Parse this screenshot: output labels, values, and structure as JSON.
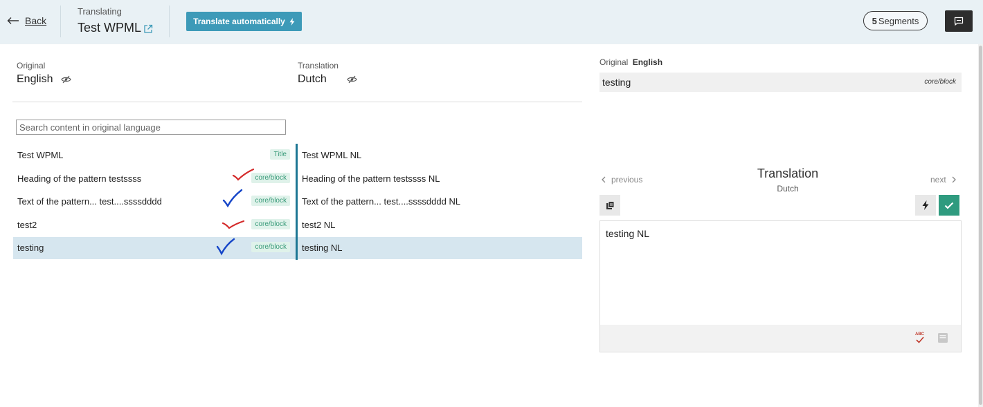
{
  "header": {
    "back_label": "Back",
    "translating_label": "Translating",
    "document_title": "Test WPML",
    "translate_auto_label": "Translate automatically",
    "segments_count": "5",
    "segments_label": "Segments"
  },
  "languages": {
    "original_label": "Original",
    "original_name": "English",
    "translation_label": "Translation",
    "translation_name": "Dutch"
  },
  "search": {
    "placeholder": "Search content in original language"
  },
  "segments": [
    {
      "original": "Test WPML",
      "badge": "Title",
      "translation": "Test WPML NL",
      "mark": "none",
      "selected": false
    },
    {
      "original": "Heading of the pattern testssss",
      "badge": "core/block",
      "translation": "Heading of the pattern testssss NL",
      "mark": "red",
      "selected": false
    },
    {
      "original": "Text of the pattern... test....ssssdddd",
      "badge": "core/block",
      "translation": "Text of the pattern... test....ssssdddd NL",
      "mark": "blue",
      "selected": false
    },
    {
      "original": "test2",
      "badge": "core/block",
      "translation": "test2 NL",
      "mark": "red",
      "selected": false
    },
    {
      "original": "testing",
      "badge": "core/block",
      "translation": "testing NL",
      "mark": "blue",
      "selected": true
    }
  ],
  "right_panel": {
    "original_label": "Original",
    "original_lang": "English",
    "original_text": "testing",
    "original_tag": "core/block",
    "previous_label": "previous",
    "next_label": "next",
    "translation_title": "Translation",
    "translation_lang": "Dutch",
    "translation_text": "testing NL",
    "spellcheck_label": "ABC"
  },
  "colors": {
    "topbar_bg": "#e9f1f5",
    "accent": "#3d9ab8",
    "confirm": "#2f9b7f",
    "selected_row": "#d6e6ef",
    "mark_red": "#d42a2a",
    "mark_blue": "#1646c8"
  },
  "icons": {
    "back": "arrow-left-icon",
    "external": "external-link-icon",
    "bolt": "lightning-icon",
    "comment": "comment-icon",
    "eye": "eye-off-icon",
    "copy": "copy-icon",
    "check": "check-icon",
    "spellcheck": "spellcheck-icon",
    "glossary": "glossary-icon"
  }
}
